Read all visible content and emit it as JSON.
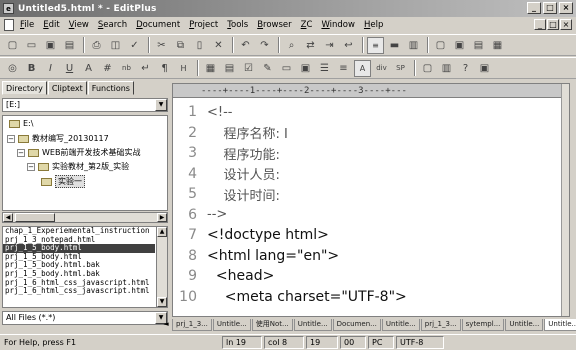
{
  "window": {
    "title": "Untitled5.html * - EditPlus",
    "app_icon": "editplus-icon",
    "controls": [
      "_",
      "□",
      "×"
    ]
  },
  "menu": {
    "items": [
      "File",
      "Edit",
      "View",
      "Search",
      "Document",
      "Project",
      "Tools",
      "Browser",
      "ZC",
      "Window",
      "Help"
    ],
    "mdi_controls": [
      "_",
      "□",
      "×"
    ]
  },
  "toolbar1": {
    "icons": [
      "new-file-icon",
      "open-icon",
      "save-icon",
      "save-all-icon",
      "print-icon",
      "print-preview-icon",
      "spellcheck-icon",
      "cut-icon",
      "copy-icon",
      "paste-icon",
      "delete-icon",
      "undo-icon",
      "redo-icon",
      "find-icon",
      "replace-icon",
      "goto-icon",
      "word-wrap-icon",
      "line-number-icon",
      "ruler-icon",
      "column-icon",
      "window-icon",
      "directory-icon",
      "cliptext-icon",
      "functions-icon"
    ]
  },
  "toolbar2": {
    "buttons": [
      "◎",
      "B",
      "I",
      "U",
      "A",
      "#",
      "nb",
      "↵",
      "¶",
      "H",
      "▦",
      "▤",
      "☑",
      "✎",
      "▭",
      "▣",
      "☰",
      "≡",
      "A",
      "div",
      "SP",
      "▢",
      "▥",
      "?",
      "▣"
    ],
    "div_label": "div",
    "sp_label": "SP"
  },
  "left_panel": {
    "tabs": [
      "Directory",
      "Cliptext",
      "Functions"
    ],
    "active_tab": "Directory",
    "drive": "[E:]",
    "tree": [
      {
        "label": "E:\\",
        "level": 0,
        "expander": ""
      },
      {
        "label": "教材编写_20130117",
        "level": 1,
        "expander": "−"
      },
      {
        "label": "WEB前端开发技术基础实战",
        "level": 2,
        "expander": "−"
      },
      {
        "label": "实验教材_第2版_实验",
        "level": 3,
        "expander": "−"
      },
      {
        "label": "实验一",
        "level": 4,
        "expander": "",
        "selected": true
      }
    ],
    "files": [
      "chap_1_Experiemental_instruction",
      "prj_1_3_notepad.html",
      "prj_1_5_body.html",
      "prj_1_5_body.html",
      "prj_1_5_body.html.bak",
      "prj_1_5_body.html.bak",
      "prj_1_6_html_css_javascript.html",
      "prj_1_6_html_css_javascript.html"
    ],
    "selected_file_index": 2,
    "filter": "All Files (*.*)"
  },
  "editor": {
    "ruler_text": "----+----1----+----2----+----3----+---",
    "lines": [
      {
        "num": "1",
        "text": "<!--",
        "kind": "comment"
      },
      {
        "num": "2",
        "text": "    程序名称: I",
        "kind": "comment"
      },
      {
        "num": "3",
        "text": "    程序功能:",
        "kind": "comment"
      },
      {
        "num": "4",
        "text": "    设计人员:",
        "kind": "comment"
      },
      {
        "num": "5",
        "text": "    设计时间:",
        "kind": "comment"
      },
      {
        "num": "6",
        "text": "-->",
        "kind": "comment"
      },
      {
        "num": "7",
        "text": "<!doctype html>",
        "kind": "code"
      },
      {
        "num": "8",
        "text": "<html lang=\"en\">",
        "kind": "code"
      },
      {
        "num": "9",
        "text": "  <head>",
        "kind": "code"
      },
      {
        "num": "10",
        "text": "    <meta charset=\"UTF-8\">",
        "kind": "code"
      }
    ]
  },
  "doc_tabs": [
    "prj_1_3...",
    "Untitle...",
    "使用Not...",
    "Untitle...",
    "Documen...",
    "Untitle...",
    "prj_1_3...",
    "sytempl...",
    "Untitle...",
    "Untitle..."
  ],
  "active_doc_tab": 9,
  "status": {
    "help": "For Help, press F1",
    "line": "ln 19",
    "col": "col 8",
    "chars": "19",
    "ins": "00",
    "mode": "PC",
    "encoding": "UTF-8"
  }
}
